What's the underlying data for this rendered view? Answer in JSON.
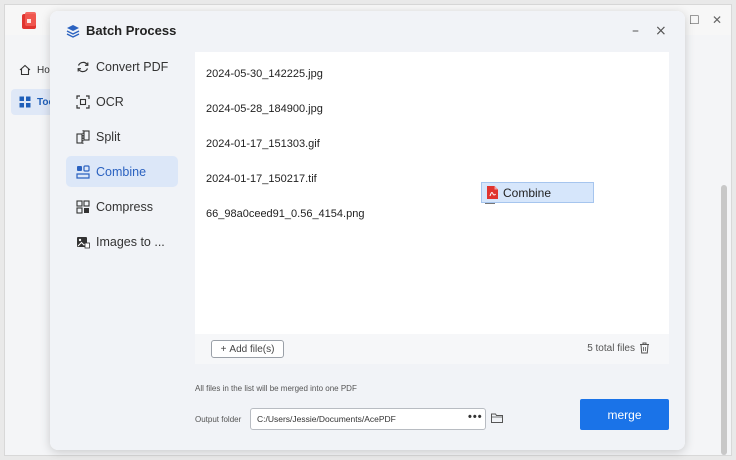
{
  "background_app": {
    "nav": [
      {
        "label": "Hon",
        "icon": "home-icon"
      },
      {
        "label": "Toc",
        "icon": "tools-grid-icon"
      }
    ],
    "controls": {
      "restore": "☐",
      "close": "✕"
    }
  },
  "modal": {
    "title": "Batch Process",
    "minimize": "–",
    "close": "×",
    "menu": [
      {
        "label": "Convert PDF",
        "icon": "convert-icon"
      },
      {
        "label": "OCR",
        "icon": "ocr-icon"
      },
      {
        "label": "Split",
        "icon": "split-icon"
      },
      {
        "label": "Combine",
        "icon": "combine-icon",
        "active": true
      },
      {
        "label": "Compress",
        "icon": "compress-icon"
      },
      {
        "label": "Images to ...",
        "icon": "images-to-icon"
      }
    ],
    "files": [
      "2024-05-30_142225.jpg",
      "2024-05-28_184900.jpg",
      "2024-01-17_151303.gif",
      "2024-01-17_150217.tif",
      "66_98a0ceed91_0.56_4154.png"
    ],
    "add_files_label": "Add file(s)",
    "total_label": "5 total files",
    "merge_note": "All files in the list will be merged into one PDF",
    "output_label": "Output folder",
    "output_path": "C:/Users/Jessie/Documents/AcePDF",
    "output_more": "•••",
    "merge_label": "merge"
  },
  "drag_ghost": {
    "label": "Combine",
    "icon": "pdf-file-icon"
  },
  "colors": {
    "accent": "#1a73e8",
    "active_bg": "#dce7f8",
    "active_text": "#2b62c0",
    "brand_red": "#e0342f"
  }
}
